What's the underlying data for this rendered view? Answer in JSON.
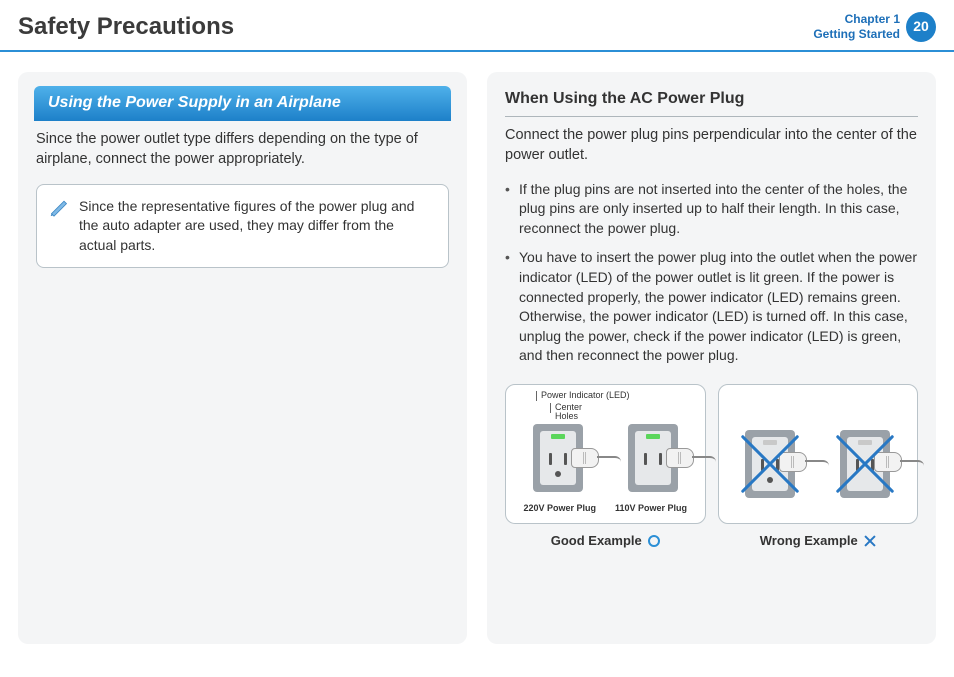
{
  "header": {
    "title": "Safety Precautions",
    "chapter_line1": "Chapter 1",
    "chapter_line2": "Getting Started",
    "page_number": "20"
  },
  "left": {
    "pill_title": "Using the Power Supply in an Airplane",
    "intro": "Since the power outlet type differs depending on the type of airplane, connect the power appropriately.",
    "note": "Since the representative figures of the power plug and the auto adapter are used, they may differ from the actual parts."
  },
  "right": {
    "subhead": "When Using the AC Power Plug",
    "intro": "Connect the power plug pins perpendicular into the center of the power outlet.",
    "bullets": [
      "If the plug pins are not inserted into the center of the holes, the plug pins are only inserted up to half their length. In this case, reconnect the power plug.",
      "You have to insert the power plug into the outlet when the power indicator (LED) of the power outlet is lit green. If the power is connected properly, the power indicator (LED) remains green.\nOtherwise, the power indicator (LED) is turned off. In this case, unplug the power, check if the power indicator (LED) is green, and then reconnect the power plug."
    ],
    "fig": {
      "led_label": "Power Indicator (LED)",
      "center_holes_label": "Center\nHoles",
      "plug_220": "220V Power Plug",
      "plug_110": "110V Power Plug",
      "good_caption": "Good Example",
      "wrong_caption": "Wrong Example"
    }
  }
}
